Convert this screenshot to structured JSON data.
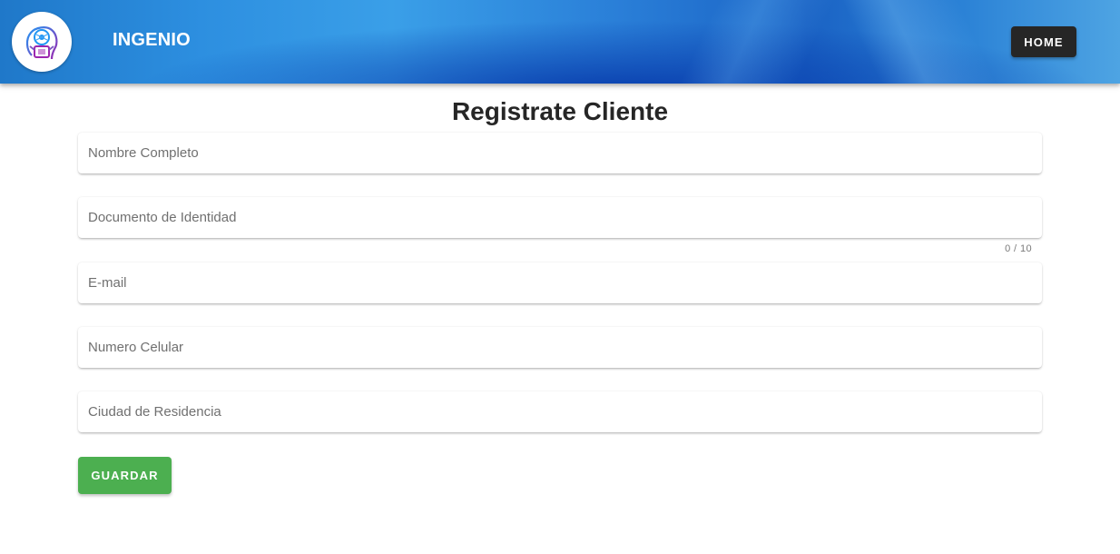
{
  "header": {
    "brand": "INGENIO",
    "home_label": "HOME",
    "logo_icon": "ai-head-icon"
  },
  "main": {
    "title": "Registrate Cliente",
    "fields": [
      {
        "placeholder": "Nombre Completo",
        "value": ""
      },
      {
        "placeholder": "Documento de Identidad",
        "value": "",
        "counter": "0 / 10"
      },
      {
        "placeholder": "E-mail",
        "value": ""
      },
      {
        "placeholder": "Numero Celular",
        "value": ""
      },
      {
        "placeholder": "Ciudad de Residencia",
        "value": ""
      }
    ],
    "save_label": "GUARDAR"
  },
  "colors": {
    "header_blue": "#2b85d8",
    "home_button": "#262626",
    "save_button": "#4caf50"
  }
}
